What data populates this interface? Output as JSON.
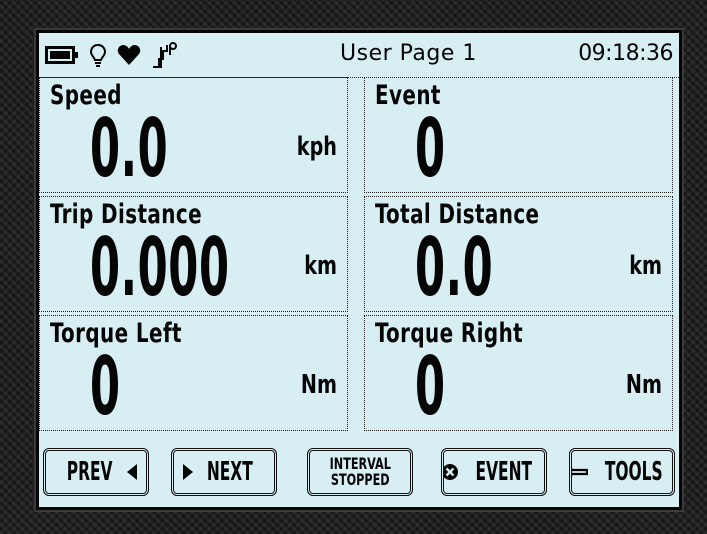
{
  "status_bar": {
    "icons": [
      "battery-icon",
      "bulb-icon",
      "heart-icon",
      "cadence-icon"
    ],
    "page_title": "User Page 1",
    "clock": "09:18:36"
  },
  "fields": [
    {
      "label": "Speed",
      "value": "0.0",
      "unit": "kph"
    },
    {
      "label": "Event",
      "value": "0",
      "unit": ""
    },
    {
      "label": "Trip Distance",
      "value": "0.000",
      "unit": "km"
    },
    {
      "label": "Total Distance",
      "value": "0.0",
      "unit": "km"
    },
    {
      "label": "Torque Left",
      "value": "0",
      "unit": "Nm"
    },
    {
      "label": "Torque Right",
      "value": "0",
      "unit": "Nm"
    }
  ],
  "buttons": {
    "prev": {
      "label": "PREV",
      "icon": "triangle-left-icon"
    },
    "next": {
      "label": "NEXT",
      "icon": "triangle-right-icon"
    },
    "interval": {
      "line1": "INTERVAL",
      "line2": "STOPPED"
    },
    "event": {
      "label": "EVENT",
      "icon": "circle-x-icon"
    },
    "tools": {
      "label": "TOOLS",
      "icon": "wrench-icon"
    }
  }
}
